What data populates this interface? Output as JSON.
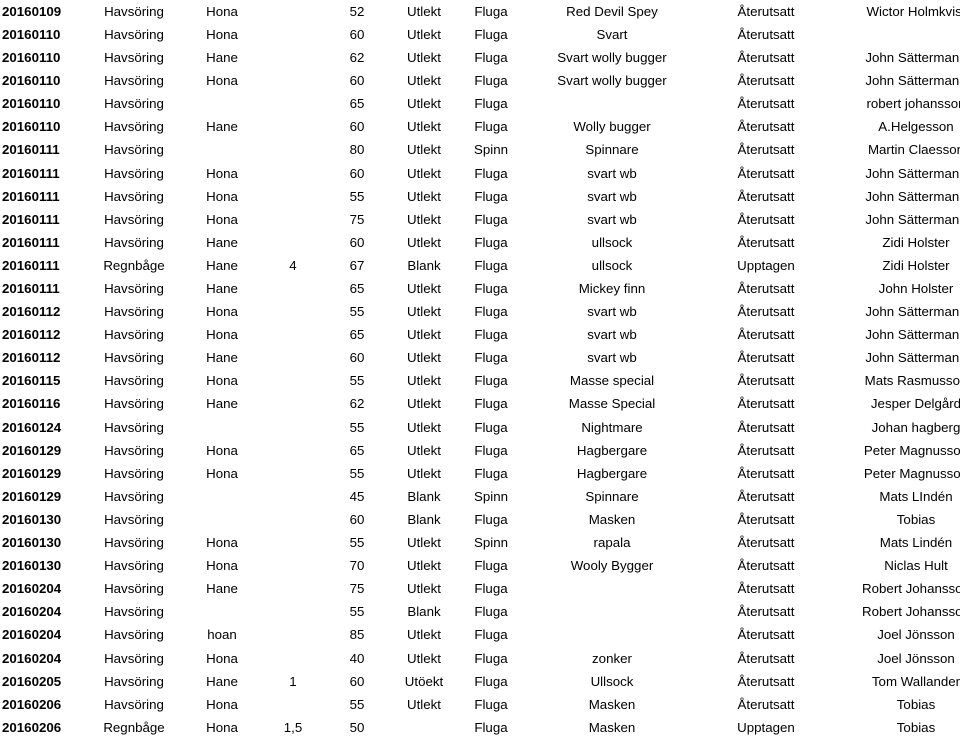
{
  "table": {
    "name": "fangstrapport-tabell",
    "columns": [
      {
        "key": "date",
        "class": "col-date"
      },
      {
        "key": "species",
        "class": "col-species"
      },
      {
        "key": "sex",
        "class": "col-sex"
      },
      {
        "key": "weight",
        "class": "col-weight"
      },
      {
        "key": "length",
        "class": "col-length"
      },
      {
        "key": "stage",
        "class": "col-stage"
      },
      {
        "key": "method",
        "class": "col-method"
      },
      {
        "key": "lure",
        "class": "col-lure"
      },
      {
        "key": "fate",
        "class": "col-fate"
      },
      {
        "key": "angler",
        "class": "col-angler"
      }
    ],
    "rows": [
      {
        "date": "20160109",
        "species": "Havsöring",
        "sex": "Hona",
        "weight": "",
        "length": "52",
        "stage": "Utlekt",
        "method": "Fluga",
        "lure": "Red Devil Spey",
        "fate": "Återutsatt",
        "angler": "Wictor Holmkvist"
      },
      {
        "date": "20160110",
        "species": "Havsöring",
        "sex": "Hona",
        "weight": "",
        "length": "60",
        "stage": "Utlekt",
        "method": "Fluga",
        "lure": "Svart",
        "fate": "Återutsatt",
        "angler": ""
      },
      {
        "date": "20160110",
        "species": "Havsöring",
        "sex": "Hane",
        "weight": "",
        "length": "62",
        "stage": "Utlekt",
        "method": "Fluga",
        "lure": "Svart wolly bugger",
        "fate": "Återutsatt",
        "angler": "John Sättermann"
      },
      {
        "date": "20160110",
        "species": "Havsöring",
        "sex": "Hona",
        "weight": "",
        "length": "60",
        "stage": "Utlekt",
        "method": "Fluga",
        "lure": "Svart wolly bugger",
        "fate": "Återutsatt",
        "angler": "John Sättermann"
      },
      {
        "date": "20160110",
        "species": "Havsöring",
        "sex": "",
        "weight": "",
        "length": "65",
        "stage": "Utlekt",
        "method": "Fluga",
        "lure": "",
        "fate": "Återutsatt",
        "angler": "robert johansson"
      },
      {
        "date": "20160110",
        "species": "Havsöring",
        "sex": "Hane",
        "weight": "",
        "length": "60",
        "stage": "Utlekt",
        "method": "Fluga",
        "lure": "Wolly bugger",
        "fate": "Återutsatt",
        "angler": "A.Helgesson"
      },
      {
        "date": "20160111",
        "species": "Havsöring",
        "sex": "",
        "weight": "",
        "length": "80",
        "stage": "Utlekt",
        "method": "Spinn",
        "lure": "Spinnare",
        "fate": "Återutsatt",
        "angler": "Martin Claesson"
      },
      {
        "date": "20160111",
        "species": "Havsöring",
        "sex": "Hona",
        "weight": "",
        "length": "60",
        "stage": "Utlekt",
        "method": "Fluga",
        "lure": "svart wb",
        "fate": "Återutsatt",
        "angler": "John Sättermann"
      },
      {
        "date": "20160111",
        "species": "Havsöring",
        "sex": "Hona",
        "weight": "",
        "length": "55",
        "stage": "Utlekt",
        "method": "Fluga",
        "lure": "svart wb",
        "fate": "Återutsatt",
        "angler": "John Sättermann"
      },
      {
        "date": "20160111",
        "species": "Havsöring",
        "sex": "Hona",
        "weight": "",
        "length": "75",
        "stage": "Utlekt",
        "method": "Fluga",
        "lure": "svart wb",
        "fate": "Återutsatt",
        "angler": "John Sättermann"
      },
      {
        "date": "20160111",
        "species": "Havsöring",
        "sex": "Hane",
        "weight": "",
        "length": "60",
        "stage": "Utlekt",
        "method": "Fluga",
        "lure": "ullsock",
        "fate": "Återutsatt",
        "angler": "Zidi Holster"
      },
      {
        "date": "20160111",
        "species": "Regnbåge",
        "sex": "Hane",
        "weight": "4",
        "length": "67",
        "stage": "Blank",
        "method": "Fluga",
        "lure": "ullsock",
        "fate": "Upptagen",
        "angler": "Zidi Holster"
      },
      {
        "date": "20160111",
        "species": "Havsöring",
        "sex": "Hane",
        "weight": "",
        "length": "65",
        "stage": "Utlekt",
        "method": "Fluga",
        "lure": "Mickey finn",
        "fate": "Återutsatt",
        "angler": "John Holster"
      },
      {
        "date": "20160112",
        "species": "Havsöring",
        "sex": "Hona",
        "weight": "",
        "length": "55",
        "stage": "Utlekt",
        "method": "Fluga",
        "lure": "svart wb",
        "fate": "Återutsatt",
        "angler": "John Sättermann"
      },
      {
        "date": "20160112",
        "species": "Havsöring",
        "sex": "Hona",
        "weight": "",
        "length": "65",
        "stage": "Utlekt",
        "method": "Fluga",
        "lure": "svart wb",
        "fate": "Återutsatt",
        "angler": "John Sättermann"
      },
      {
        "date": "20160112",
        "species": "Havsöring",
        "sex": "Hane",
        "weight": "",
        "length": "60",
        "stage": "Utlekt",
        "method": "Fluga",
        "lure": "svart wb",
        "fate": "Återutsatt",
        "angler": "John Sättermann"
      },
      {
        "date": "20160115",
        "species": "Havsöring",
        "sex": "Hona",
        "weight": "",
        "length": "55",
        "stage": "Utlekt",
        "method": "Fluga",
        "lure": "Masse special",
        "fate": "Återutsatt",
        "angler": "Mats Rasmusson"
      },
      {
        "date": "20160116",
        "species": "Havsöring",
        "sex": "Hane",
        "weight": "",
        "length": "62",
        "stage": "Utlekt",
        "method": "Fluga",
        "lure": "Masse Special",
        "fate": "Återutsatt",
        "angler": "Jesper Delgård"
      },
      {
        "date": "20160124",
        "species": "Havsöring",
        "sex": "",
        "weight": "",
        "length": "55",
        "stage": "Utlekt",
        "method": "Fluga",
        "lure": "Nightmare",
        "fate": "Återutsatt",
        "angler": "Johan hagberg"
      },
      {
        "date": "20160129",
        "species": "Havsöring",
        "sex": "Hona",
        "weight": "",
        "length": "65",
        "stage": "Utlekt",
        "method": "Fluga",
        "lure": "Hagbergare",
        "fate": "Återutsatt",
        "angler": "Peter Magnusson"
      },
      {
        "date": "20160129",
        "species": "Havsöring",
        "sex": "Hona",
        "weight": "",
        "length": "55",
        "stage": "Utlekt",
        "method": "Fluga",
        "lure": "Hagbergare",
        "fate": "Återutsatt",
        "angler": "Peter Magnusson"
      },
      {
        "date": "20160129",
        "species": "Havsöring",
        "sex": "",
        "weight": "",
        "length": "45",
        "stage": "Blank",
        "method": "Spinn",
        "lure": "Spinnare",
        "fate": "Återutsatt",
        "angler": "Mats LIndén"
      },
      {
        "date": "20160130",
        "species": "Havsöring",
        "sex": "",
        "weight": "",
        "length": "60",
        "stage": "Blank",
        "method": "Fluga",
        "lure": "Masken",
        "fate": "Återutsatt",
        "angler": "Tobias"
      },
      {
        "date": "20160130",
        "species": "Havsöring",
        "sex": "Hona",
        "weight": "",
        "length": "55",
        "stage": "Utlekt",
        "method": "Spinn",
        "lure": "rapala",
        "fate": "Återutsatt",
        "angler": "Mats Lindén"
      },
      {
        "date": "20160130",
        "species": "Havsöring",
        "sex": "Hona",
        "weight": "",
        "length": "70",
        "stage": "Utlekt",
        "method": "Fluga",
        "lure": "Wooly Bygger",
        "fate": "Återutsatt",
        "angler": "Niclas Hult"
      },
      {
        "date": "20160204",
        "species": "Havsöring",
        "sex": "Hane",
        "weight": "",
        "length": "75",
        "stage": "Utlekt",
        "method": "Fluga",
        "lure": "",
        "fate": "Återutsatt",
        "angler": "Robert Johansson"
      },
      {
        "date": "20160204",
        "species": "Havsöring",
        "sex": "",
        "weight": "",
        "length": "55",
        "stage": "Blank",
        "method": "Fluga",
        "lure": "",
        "fate": "Återutsatt",
        "angler": "Robert Johansson"
      },
      {
        "date": "20160204",
        "species": "Havsöring",
        "sex": "hoan",
        "weight": "",
        "length": "85",
        "stage": "Utlekt",
        "method": "Fluga",
        "lure": "",
        "fate": "Återutsatt",
        "angler": "Joel Jönsson"
      },
      {
        "date": "20160204",
        "species": "Havsöring",
        "sex": "Hona",
        "weight": "",
        "length": "40",
        "stage": "Utlekt",
        "method": "Fluga",
        "lure": "zonker",
        "fate": "Återutsatt",
        "angler": "Joel Jönsson"
      },
      {
        "date": "20160205",
        "species": "Havsöring",
        "sex": "Hane",
        "weight": "1",
        "length": "60",
        "stage": "Utöekt",
        "method": "Fluga",
        "lure": "Ullsock",
        "fate": "Återutsatt",
        "angler": "Tom Wallander"
      },
      {
        "date": "20160206",
        "species": "Havsöring",
        "sex": "Hona",
        "weight": "",
        "length": "55",
        "stage": "Utlekt",
        "method": "Fluga",
        "lure": "Masken",
        "fate": "Återutsatt",
        "angler": "Tobias"
      },
      {
        "date": "20160206",
        "species": "Regnbåge",
        "sex": "Hona",
        "weight": "1,5",
        "length": "50",
        "stage": "",
        "method": "Fluga",
        "lure": "Masken",
        "fate": "Upptagen",
        "angler": "Tobias"
      }
    ]
  }
}
